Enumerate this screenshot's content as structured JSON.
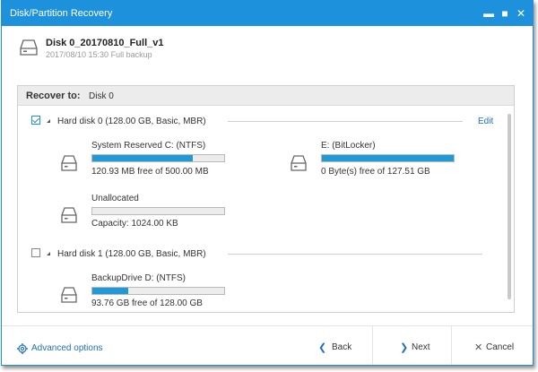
{
  "window": {
    "title": "Disk/Partition Recovery",
    "controls": {
      "minimize": "▬",
      "maximize": "■",
      "close": "✕"
    },
    "accent_color": "#1e91dd"
  },
  "backup": {
    "name": "Disk 0_20170810_Full_v1",
    "meta": "2017/08/10 15:30 Full backup",
    "icon": "hard-drive-icon"
  },
  "recover": {
    "label": "Recover to:",
    "target": "Disk 0"
  },
  "disks": [
    {
      "checked": true,
      "title": "Hard disk 0 (128.00 GB, Basic, MBR)",
      "edit_label": "Edit",
      "partitions": [
        {
          "name": "System Reserved C: (NTFS)",
          "used_fraction": 0.76,
          "info": "120.93 MB free of 500.00 MB"
        },
        {
          "name": "E: (BitLocker)",
          "used_fraction": 1.0,
          "info": "0 Byte(s) free of 127.51 GB"
        },
        {
          "name": "Unallocated",
          "used_fraction": 0.0,
          "info": "Capacity: 1024.00 KB"
        }
      ]
    },
    {
      "checked": false,
      "title": "Hard disk 1 (128.00 GB, Basic, MBR)",
      "partitions": [
        {
          "name": "BackupDrive D: (NTFS)",
          "used_fraction": 0.27,
          "info": "93.76 GB free of 128.00 GB"
        }
      ]
    }
  ],
  "footer": {
    "advanced_options": "Advanced options",
    "back": "Back",
    "next": "Next",
    "cancel": "Cancel",
    "back_glyph": "❮",
    "next_glyph": "❯",
    "cancel_glyph": "✕",
    "link_color": "#1e6fc1"
  }
}
